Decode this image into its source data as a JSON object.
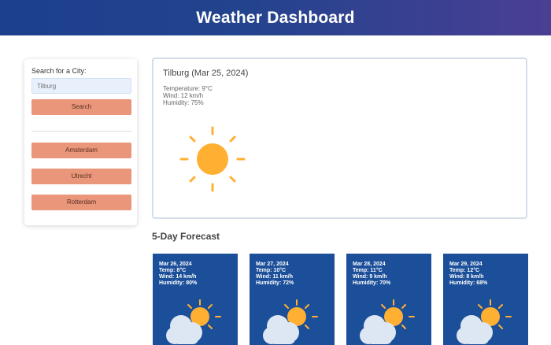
{
  "header": {
    "title": "Weather Dashboard"
  },
  "sidebar": {
    "search_label": "Search for a City:",
    "search_placeholder": "Tilburg",
    "search_button": "Search",
    "history": [
      "Amsterdam",
      "Utrecht",
      "Rotterdam"
    ]
  },
  "today": {
    "title": "Tilburg (Mar 25, 2024)",
    "temperature": "Temperature: 9°C",
    "wind": "Wind: 12 km/h",
    "humidity": "Humidity: 75%",
    "icon": "sun-icon"
  },
  "forecast": {
    "title": "5-Day Forecast",
    "cards": [
      {
        "date": "Mar 26, 2024",
        "temp": "Temp: 8°C",
        "wind": "Wind: 14 km/h",
        "humidity": "Humidity: 80%",
        "icon": "partly-cloudy-icon"
      },
      {
        "date": "Mar 27, 2024",
        "temp": "Temp: 10°C",
        "wind": "Wind: 11 km/h",
        "humidity": "Humidity: 72%",
        "icon": "partly-cloudy-icon"
      },
      {
        "date": "Mar 28, 2024",
        "temp": "Temp: 11°C",
        "wind": "Wind: 9 km/h",
        "humidity": "Humidity: 70%",
        "icon": "partly-cloudy-icon"
      },
      {
        "date": "Mar 29, 2024",
        "temp": "Temp: 12°C",
        "wind": "Wind: 8 km/h",
        "humidity": "Humidity: 68%",
        "icon": "partly-cloudy-icon"
      }
    ]
  },
  "colors": {
    "header_start": "#1c3f8e",
    "header_end": "#4a3f93",
    "button": "#e9967a",
    "card": "#1c4f9a",
    "sun": "#ffb032"
  }
}
